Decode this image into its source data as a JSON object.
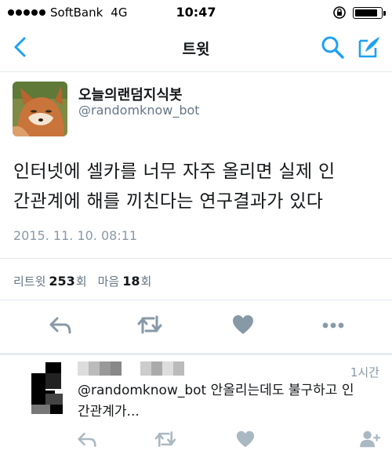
{
  "status_bar": {
    "carrier": "SoftBank",
    "network": "4G",
    "time": "10:47",
    "battery_level": 0.9
  },
  "nav": {
    "title": "트윗",
    "back_icon": "chevron-left-icon",
    "search_icon": "search-icon",
    "compose_icon": "compose-icon",
    "accent_color": "#1da1f2"
  },
  "tweet": {
    "display_name": "오늘의랜덤지식봇",
    "handle": "@randomknow_bot",
    "text_line1": "인터넷에 셀카를 너무 자주 올리면 실제 인",
    "text_line2": "간관계에 해를 끼친다는 연구결과가 있다",
    "timestamp": "2015. 11. 10. 08:11",
    "retweets_label": "리트윗",
    "retweets_count": "253",
    "retweets_unit": "회",
    "likes_label": "마음",
    "likes_count": "18",
    "likes_unit": "회"
  },
  "reply": {
    "time": "1시간",
    "text_line1": "@randomknow_bot 안올리는데도 불구하고 인",
    "text_line2": "간관계가..."
  }
}
